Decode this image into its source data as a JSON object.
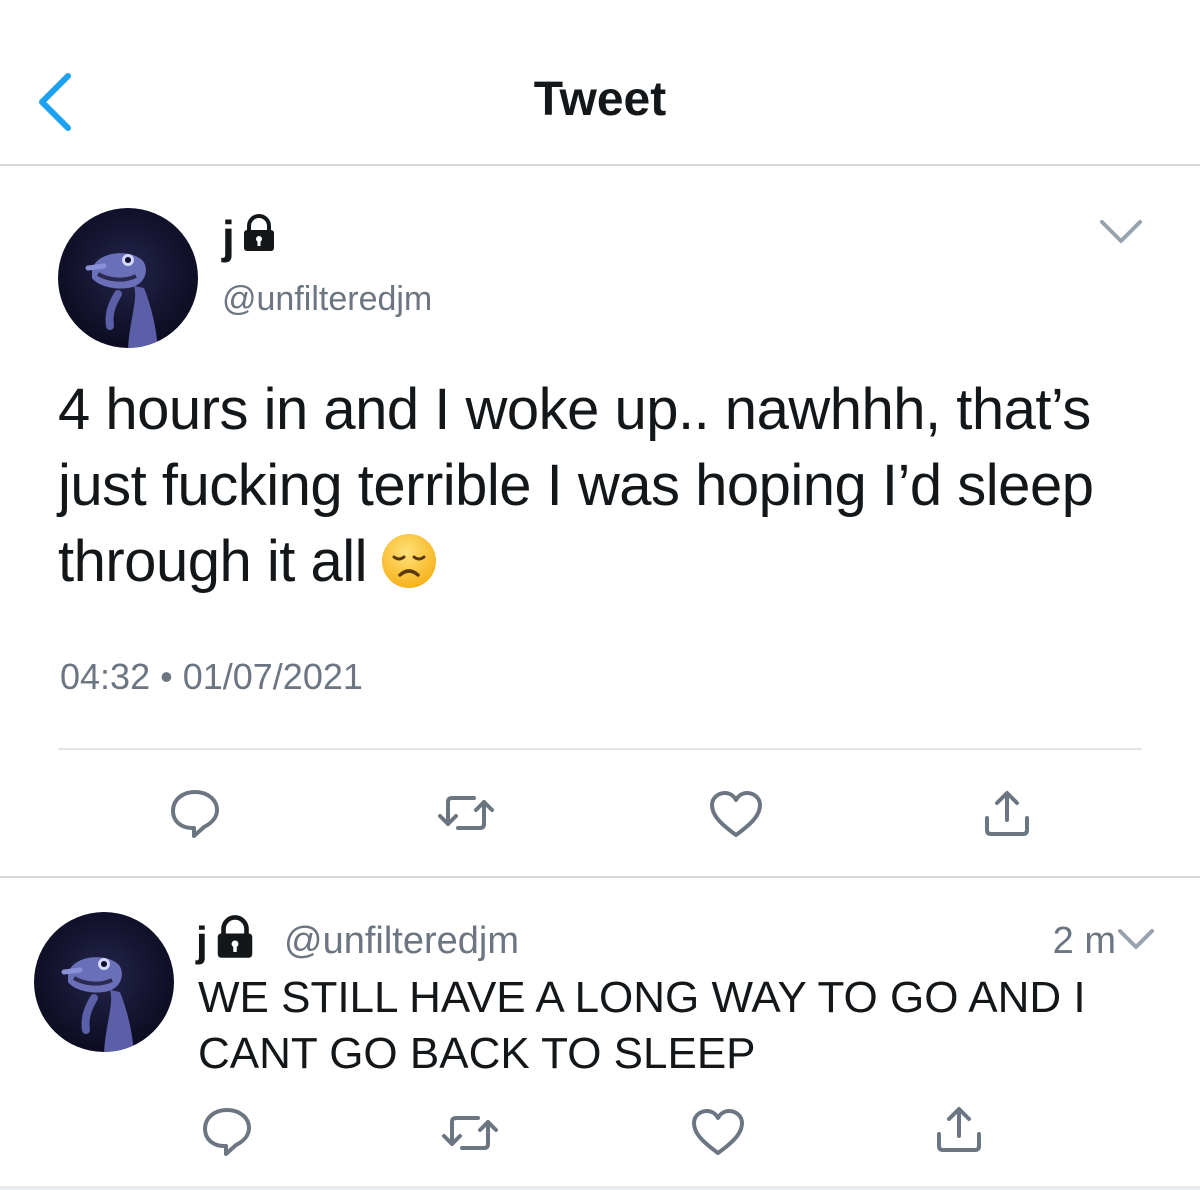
{
  "nav": {
    "title": "Tweet"
  },
  "tweet": {
    "name": "j",
    "handle": "@unfilteredjm",
    "text": "4 hours in and I woke up.. nawhhh, that’s just fucking terrible I was hoping I’d sleep through it all",
    "emoji": "disappointed-face",
    "time": "04:32",
    "separator": "•",
    "date": "01/07/2021"
  },
  "reply": {
    "name": "j",
    "handle": "@unfilteredjm",
    "time": "2 m",
    "text": "WE STILL HAVE A LONG WAY TO GO AND I CANT GO BACK TO SLEEP"
  },
  "icons": {
    "back": "chevron-left-icon",
    "caret": "chevron-down-icon",
    "lock": "lock-icon",
    "reply": "reply-icon",
    "retweet": "retweet-icon",
    "like": "heart-icon",
    "share": "share-icon"
  },
  "colors": {
    "accent": "#1da1f2",
    "muted": "#6b7682",
    "text": "#14171a"
  }
}
